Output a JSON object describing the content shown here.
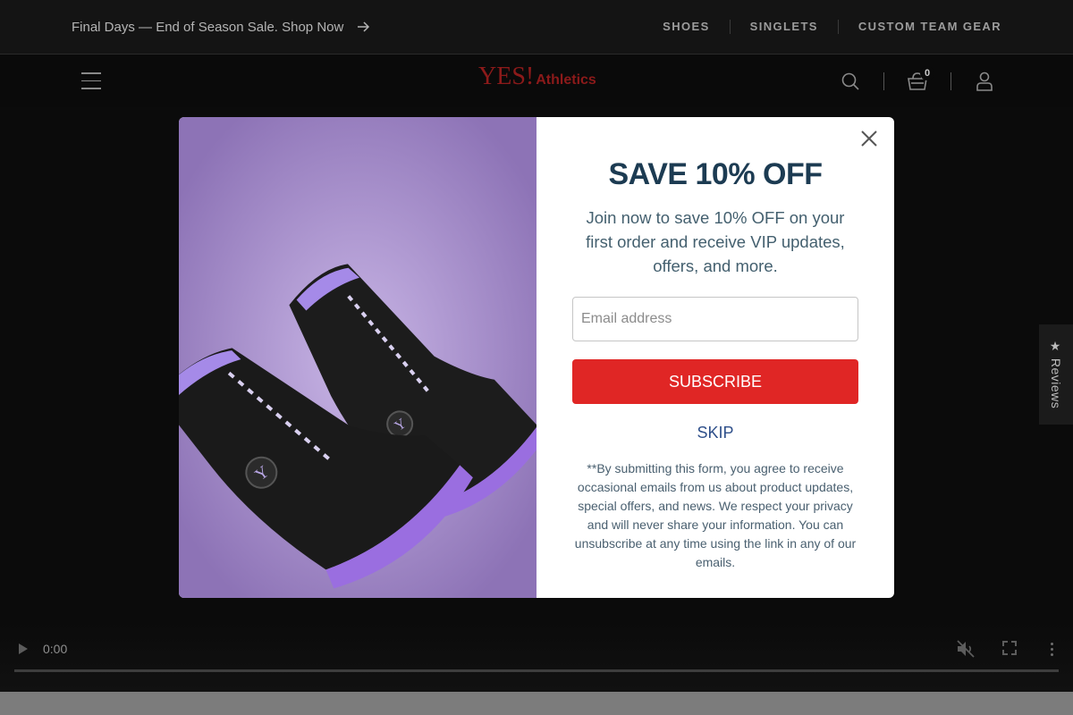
{
  "announcement": {
    "text": "Final Days — End of Season Sale. Shop Now",
    "arrow_icon": "arrow-right-icon"
  },
  "top_nav": {
    "items": [
      {
        "label": "SHOES"
      },
      {
        "label": "SINGLETS"
      },
      {
        "label": "CUSTOM TEAM GEAR"
      }
    ]
  },
  "header": {
    "logo_main": "YES!",
    "logo_sub": "Athletics",
    "cart_count": "0",
    "icons": [
      "menu-icon",
      "search-icon",
      "cart-icon",
      "account-icon"
    ]
  },
  "modal": {
    "title": "SAVE 10% OFF",
    "description": "Join now to save 10% OFF on your first order and receive VIP updates, offers, and more.",
    "email_placeholder": "Email address",
    "email_value": "",
    "subscribe_label": "SUBSCRIBE",
    "skip_label": "SKIP",
    "disclaimer": "**By submitting this form, you agree to receive occasional emails from us about product updates, special offers, and news. We respect your privacy and will never share your information. You can unsubscribe at any time using the link in any of our emails.",
    "image": "wrestling-shoes-purple-black",
    "shoe_badge_letter": "Y"
  },
  "video": {
    "time": "0:00",
    "progress": 0,
    "icons": [
      "play-icon",
      "mute-icon",
      "fullscreen-icon",
      "more-options-icon"
    ]
  },
  "reviews_tab": {
    "label": "★ Reviews"
  },
  "colors": {
    "brand_red": "#e02625",
    "logo_red": "#8c1a1a",
    "title_navy": "#1c3b52",
    "skip_blue": "#2e4f8a",
    "image_lavender": "#a58ccb",
    "header_black": "#0a0a0a"
  }
}
